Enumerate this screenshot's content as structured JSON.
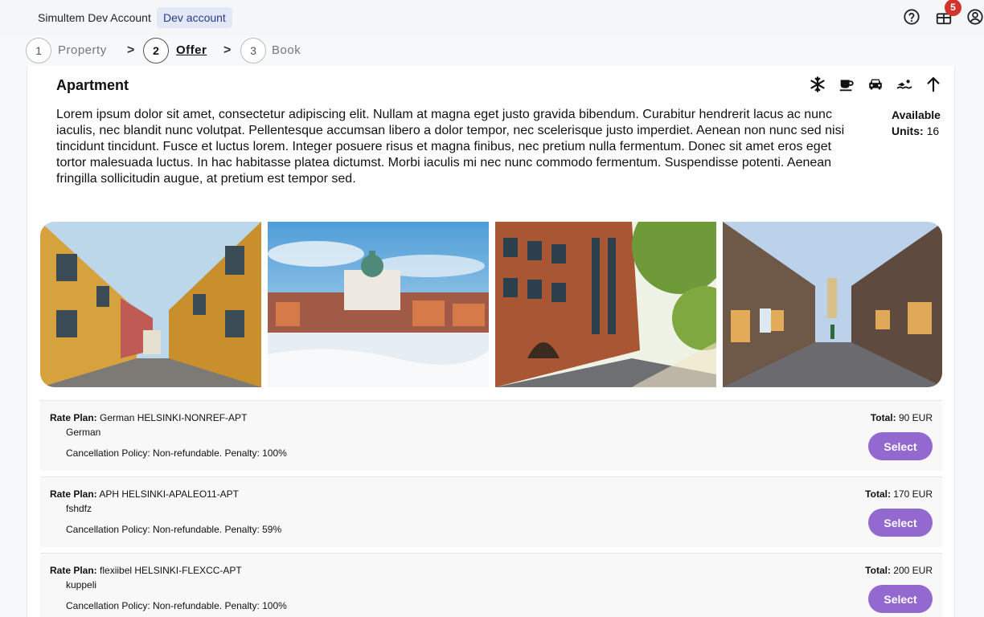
{
  "header": {
    "account_name": "Simultem Dev Account",
    "account_badge": "Dev account",
    "notification_count": "5"
  },
  "stepper": {
    "steps": [
      {
        "number": "1",
        "label": "Property"
      },
      {
        "number": "2",
        "label": "Offer"
      },
      {
        "number": "3",
        "label": "Book"
      }
    ],
    "separator": ">"
  },
  "room": {
    "title": "Apartment",
    "description": "Lorem ipsum dolor sit amet, consectetur adipiscing elit. Nullam at magna eget justo gravida bibendum. Curabitur hendrerit lacus ac nunc iaculis, nec blandit nunc volutpat. Pellentesque accumsan libero a dolor tempor, nec scelerisque justo imperdiet. Aenean non nunc sed nisi tincidunt tincidunt. Fusce et luctus lorem. Integer posuere risus et magna finibus, nec pretium nulla fermentum. Donec sit amet eros eget tortor malesuada luctus. In hac habitasse platea dictumst. Morbi iaculis mi nec nunc commodo fermentum. Suspendisse potenti. Aenean fringilla sollicitudin augue, at pretium est tempor sed.",
    "available_label": "Available Units:",
    "available_value": "16",
    "amenities": [
      "snowflake-icon",
      "coffee-cup-icon",
      "car-icon",
      "swimmer-icon",
      "arrow-up-icon"
    ]
  },
  "rate_plans": [
    {
      "label": "Rate Plan:",
      "name": "German HELSINKI-NONREF-APT",
      "description": "German",
      "policy": "Cancellation Policy: Non-refundable. Penalty: 100%",
      "total_label": "Total:",
      "total_value": "90 EUR",
      "button": "Select"
    },
    {
      "label": "Rate Plan:",
      "name": "APH HELSINKI-APALEO11-APT",
      "description": "fshdfz",
      "policy": "Cancellation Policy: Non-refundable. Penalty: 59%",
      "total_label": "Total:",
      "total_value": "170 EUR",
      "button": "Select"
    },
    {
      "label": "Rate Plan:",
      "name": "flexiibel HELSINKI-FLEXCC-APT",
      "description": "kuppeli",
      "policy": "Cancellation Policy: Non-refundable. Penalty: 100%",
      "total_label": "Total:",
      "total_value": "200 EUR",
      "button": "Select"
    }
  ],
  "colors": {
    "accent": "#9368cf",
    "badge_red": "#d0342c",
    "account_badge_bg": "#e3e8f7"
  }
}
